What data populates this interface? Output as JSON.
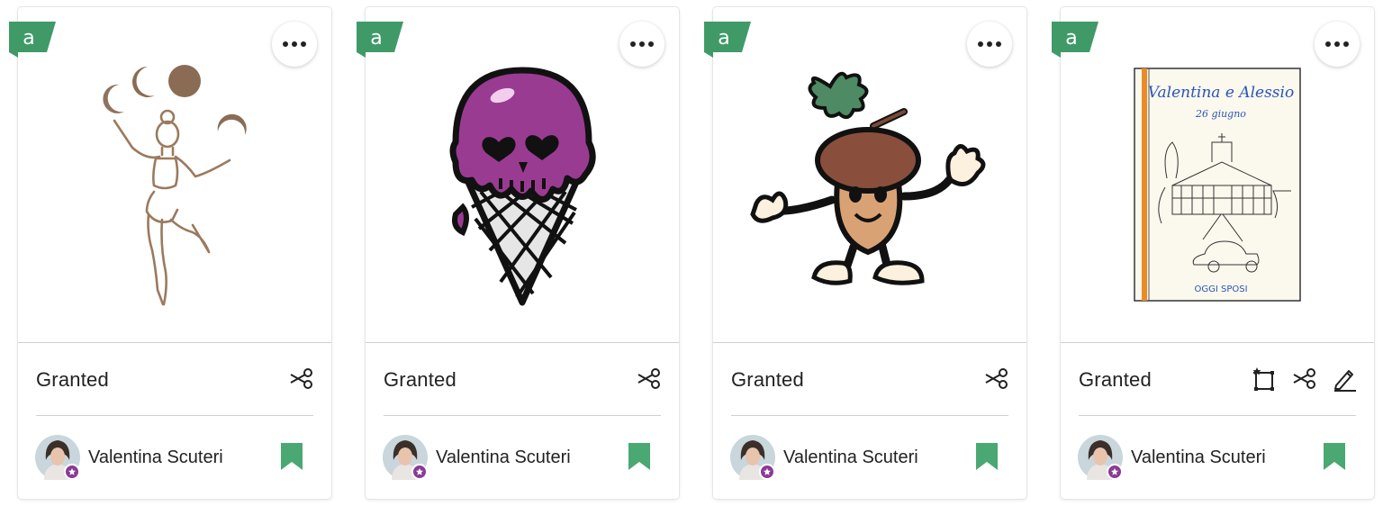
{
  "cards": [
    {
      "license": "Granted",
      "designer": "Valentina Scuteri",
      "badge_letter": "a",
      "tools": [
        "cut-icon"
      ]
    },
    {
      "license": "Granted",
      "designer": "Valentina Scuteri",
      "badge_letter": "a",
      "tools": [
        "cut-icon"
      ]
    },
    {
      "license": "Granted",
      "designer": "Valentina Scuteri",
      "badge_letter": "a",
      "tools": [
        "cut-icon"
      ]
    },
    {
      "license": "Granted",
      "designer": "Valentina Scuteri",
      "badge_letter": "a",
      "tools": [
        "print-then-cut-icon",
        "cut-icon",
        "draw-icon"
      ],
      "book": {
        "title": "Valentina e Alessio",
        "subtitle": "26 giugno",
        "footer": "OGGI SPOSI"
      }
    }
  ],
  "colors": {
    "accent_green": "#3f9a68",
    "bookmark_green": "#4aa872",
    "avatar_badge": "#8b3a96"
  }
}
